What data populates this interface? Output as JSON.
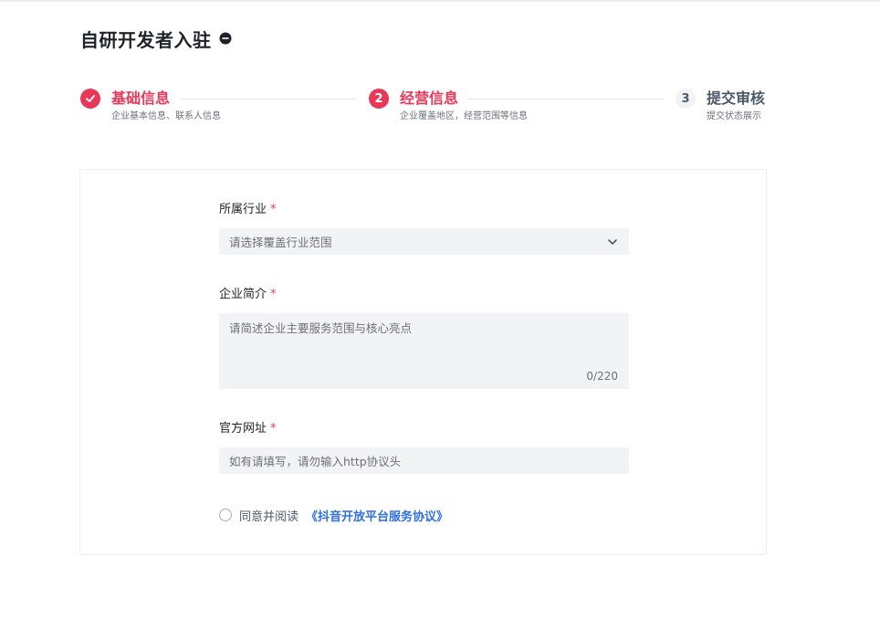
{
  "header": {
    "title": "自研开发者入驻"
  },
  "steps": [
    {
      "number": "✓",
      "title": "基础信息",
      "desc": "企业基本信息、联系人信息",
      "state": "completed"
    },
    {
      "number": "2",
      "title": "经营信息",
      "desc": "企业覆盖地区，经营范围等信息",
      "state": "active"
    },
    {
      "number": "3",
      "title": "提交审核",
      "desc": "提交状态展示",
      "state": "pending"
    }
  ],
  "form": {
    "industry": {
      "label": "所属行业",
      "required_mark": "*",
      "placeholder": "请选择覆盖行业范围"
    },
    "intro": {
      "label": "企业简介",
      "required_mark": "*",
      "placeholder": "请简述企业主要服务范围与核心亮点",
      "counter": "0/220"
    },
    "website": {
      "label": "官方网址",
      "required_mark": "*",
      "placeholder": "如有请填写，请勿输入http协议头"
    },
    "agreement": {
      "text": "同意并阅读",
      "link": "《抖音开放平台服务协议》"
    }
  },
  "colors": {
    "accent": "#e8385a",
    "link": "#2f6ee6",
    "field_bg": "#f2f3f5"
  }
}
